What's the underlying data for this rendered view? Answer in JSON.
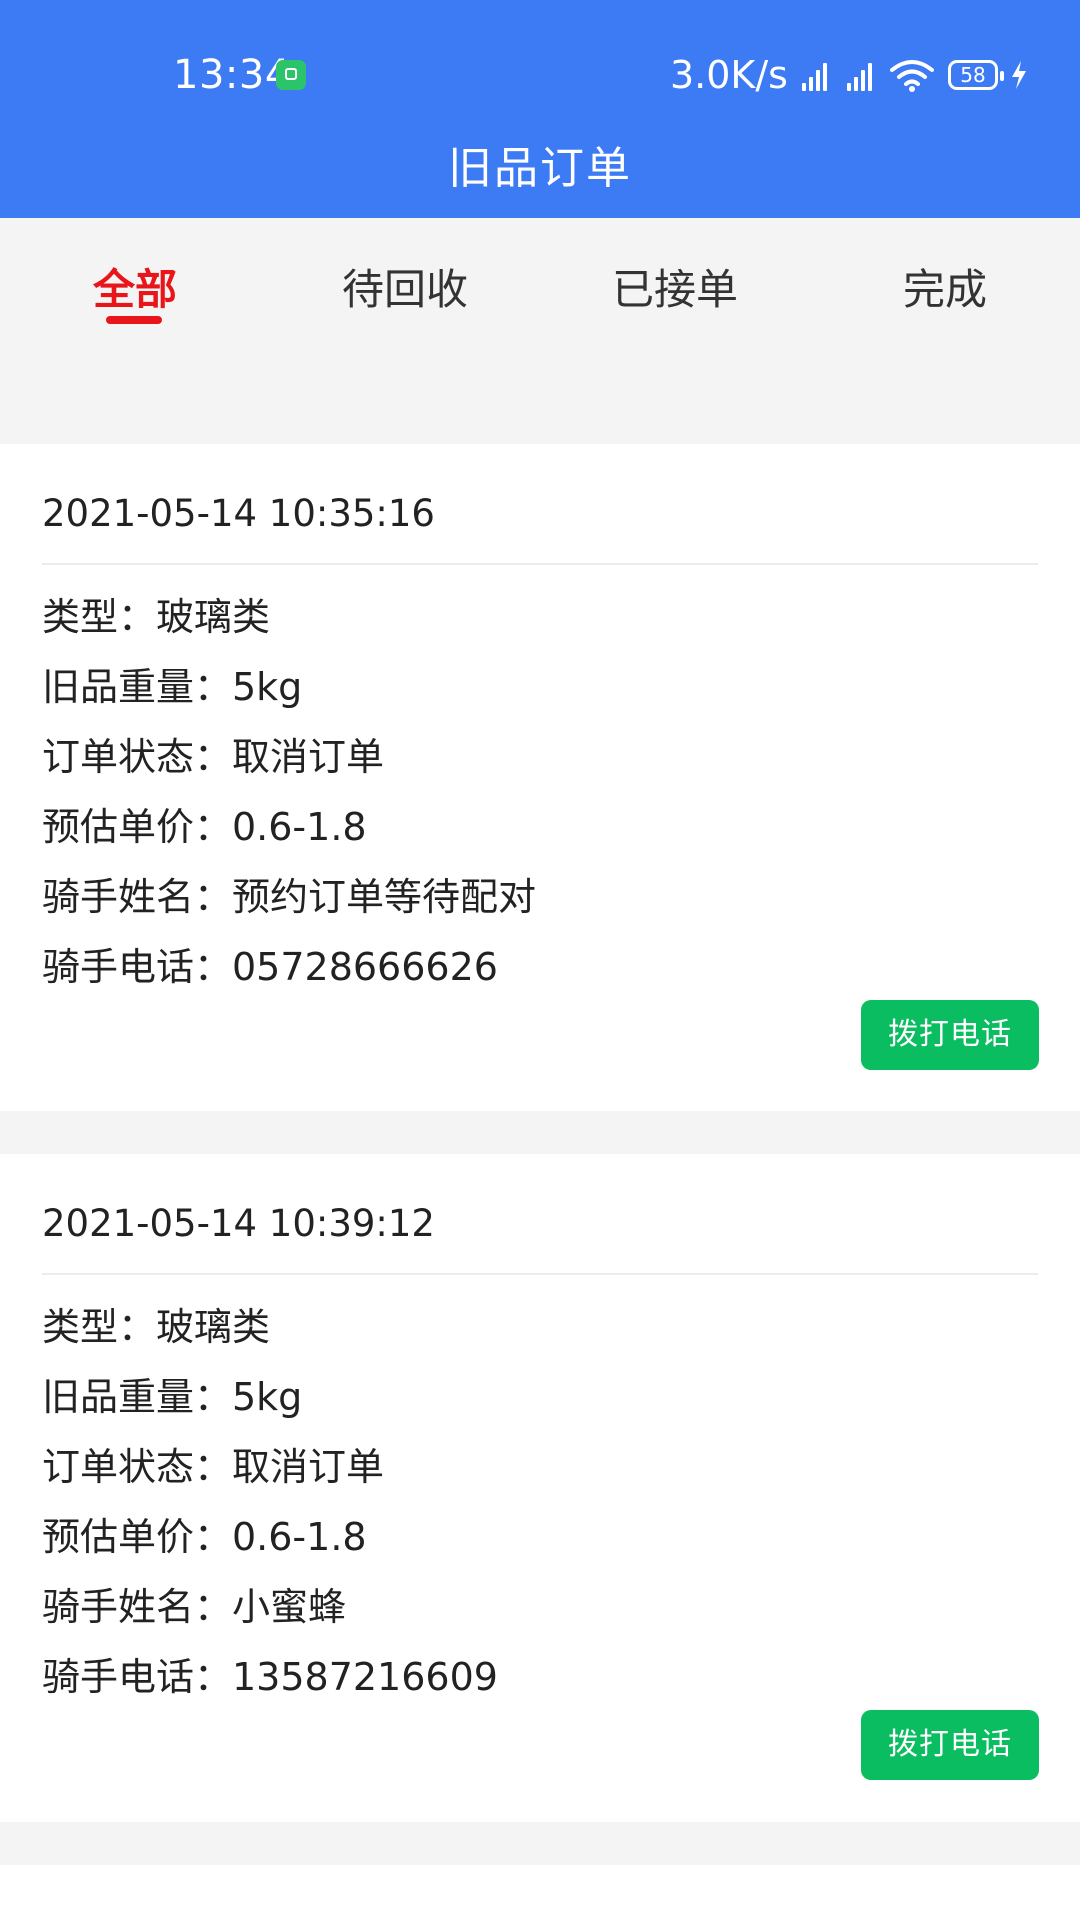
{
  "status_bar": {
    "time": "13:34",
    "net_speed": "3.0K/s",
    "battery": "58",
    "icons": [
      "app-notification-icon",
      "signal-icon",
      "signal-icon",
      "wifi-icon",
      "battery-icon",
      "charging-icon"
    ]
  },
  "header": {
    "title": "旧品订单",
    "color": "#3d7bf5"
  },
  "tabs": [
    {
      "label": "全部",
      "active": true
    },
    {
      "label": "待回收",
      "active": false
    },
    {
      "label": "已接单",
      "active": false
    },
    {
      "label": "完成",
      "active": false
    }
  ],
  "accent_color": "#e8161a",
  "button_color": "#0bbd61",
  "orders": [
    {
      "time": "2021-05-14 10:35:16",
      "type": "类型：玻璃类",
      "weight": "旧品重量：5kg",
      "status": "订单状态：取消订单",
      "price": "预估单价：0.6-1.8",
      "rider_name": "骑手姓名：预约订单等待配对",
      "rider_phone": "骑手电话：05728666626",
      "call_label": "拨打电话"
    },
    {
      "time": "2021-05-14 10:39:12",
      "type": "类型：玻璃类",
      "weight": "旧品重量：5kg",
      "status": "订单状态：取消订单",
      "price": "预估单价：0.6-1.8",
      "rider_name": "骑手姓名：小蜜蜂",
      "rider_phone": "骑手电话：13587216609",
      "call_label": "拨打电话"
    }
  ]
}
